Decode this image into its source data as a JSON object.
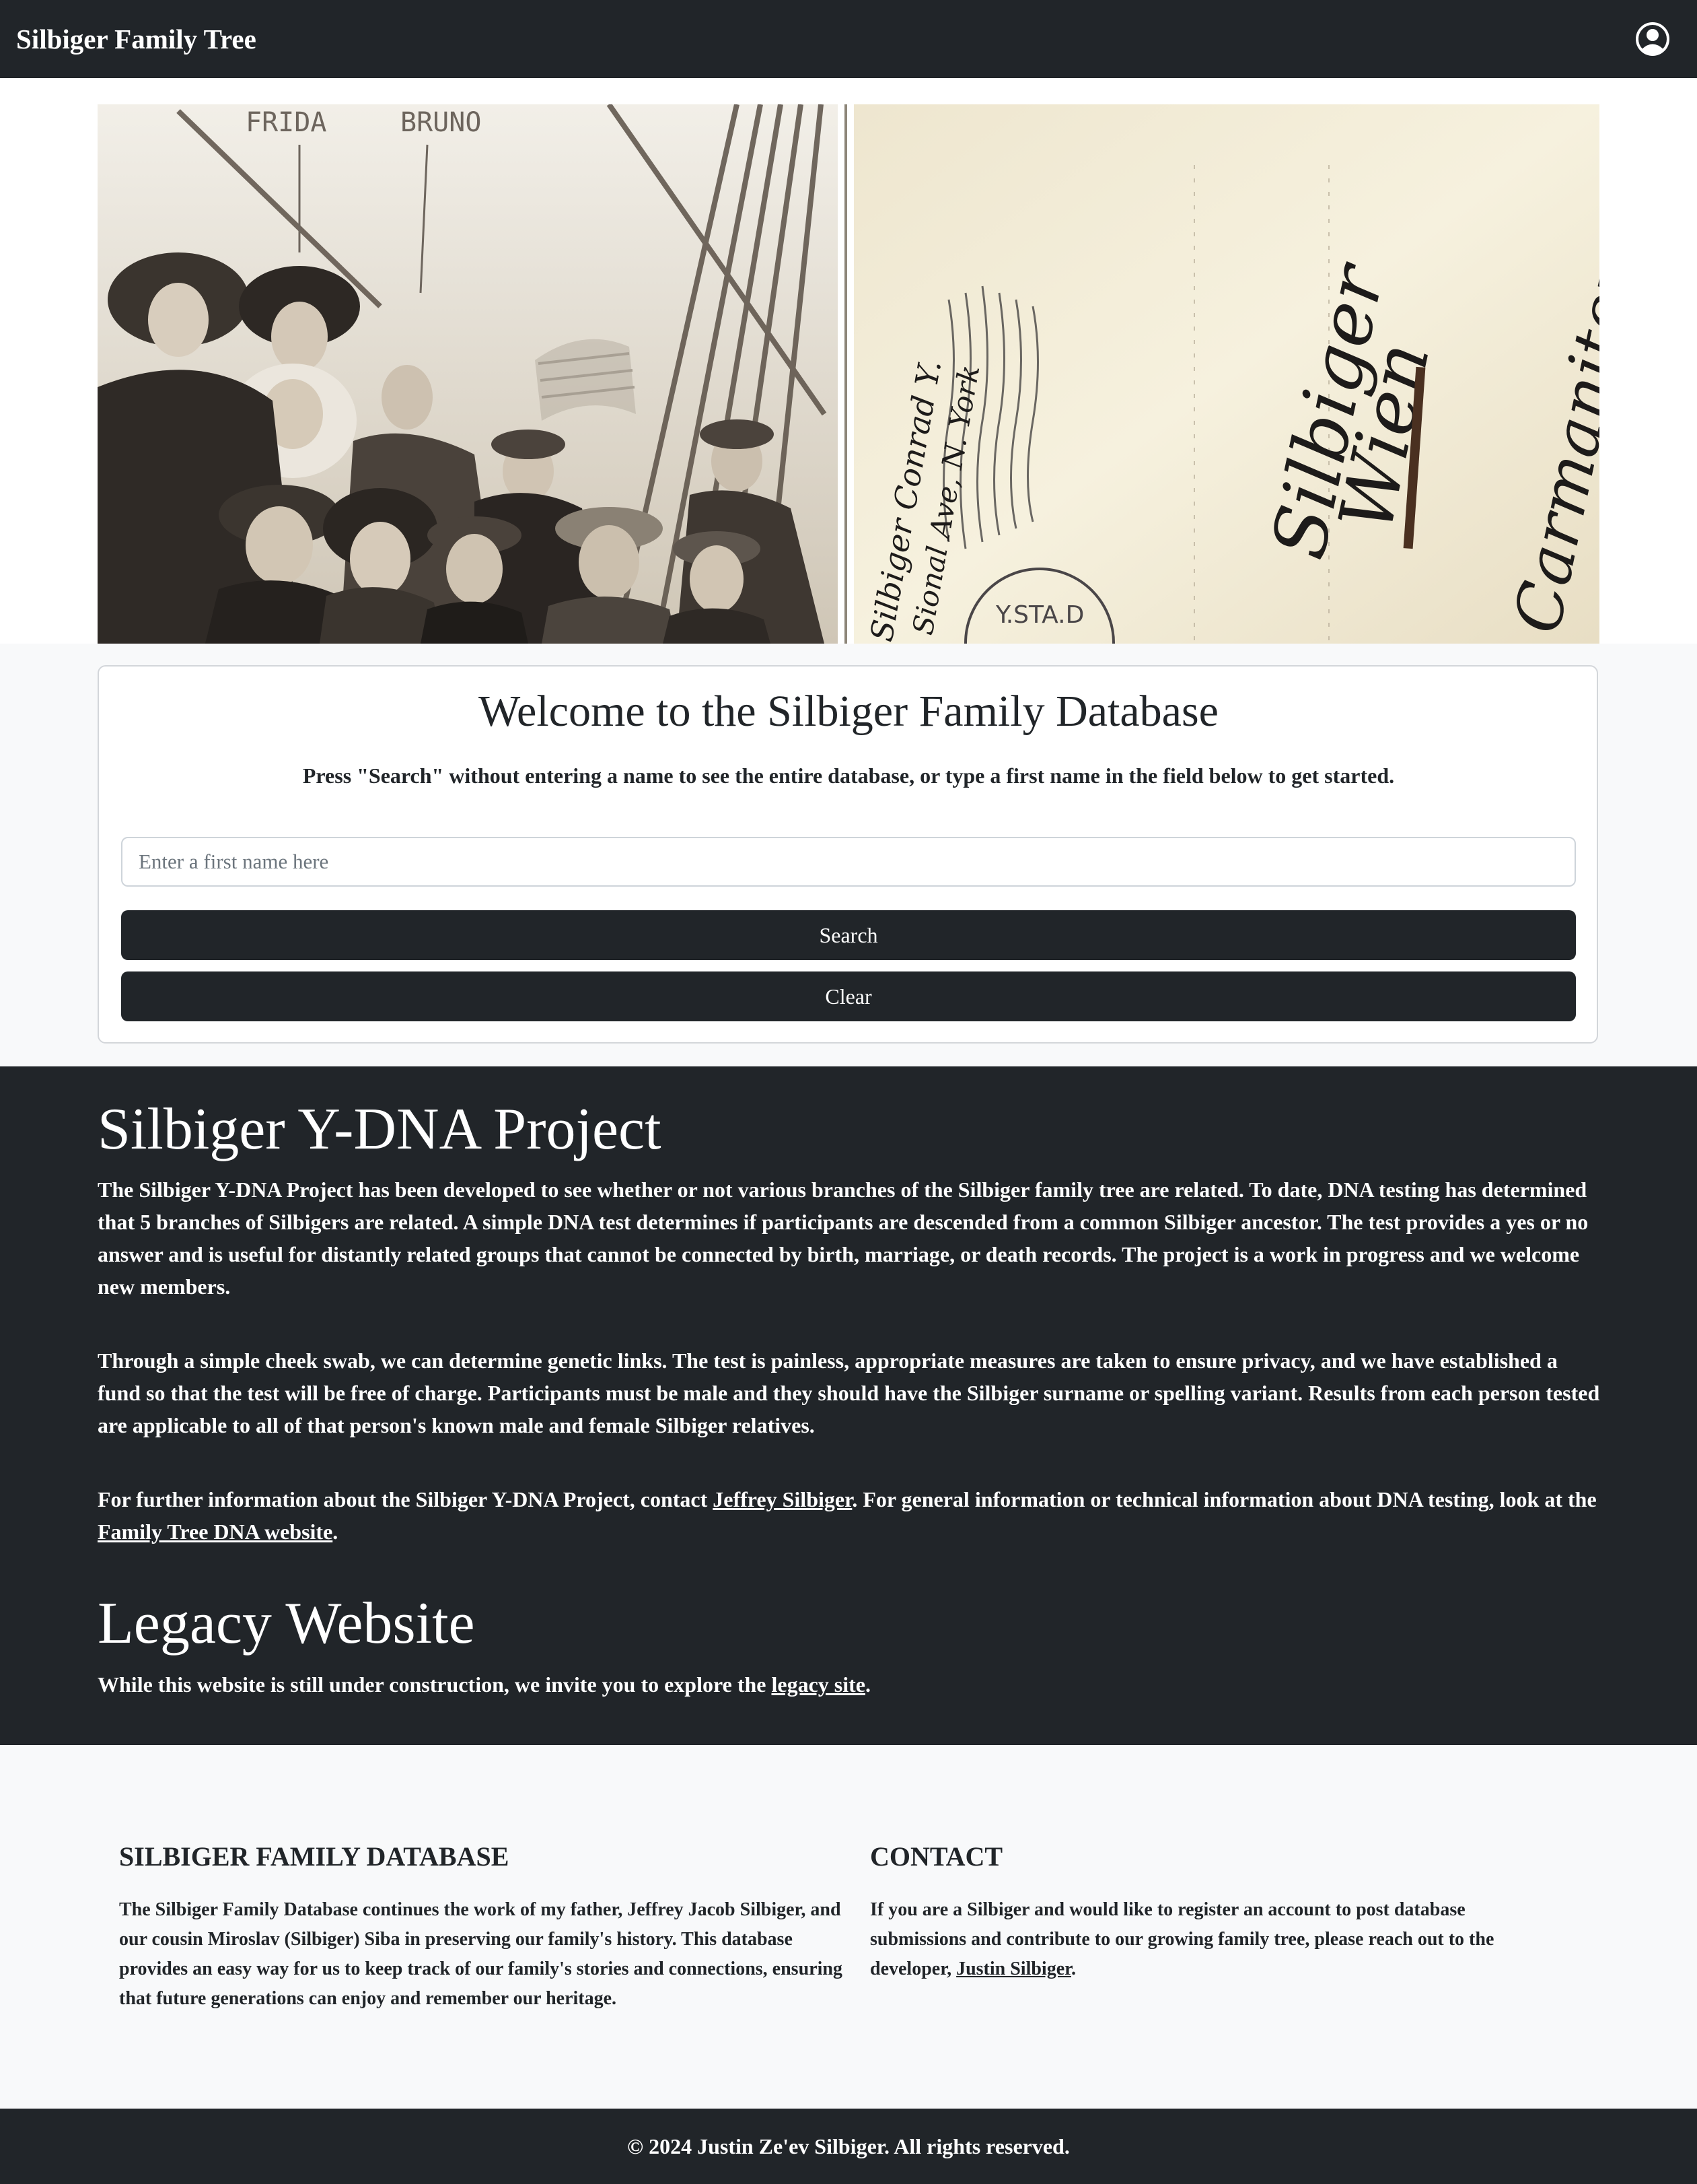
{
  "navbar": {
    "brand": "Silbiger Family Tree",
    "user_icon": "user-circle-icon"
  },
  "hero": {
    "photo_annotations": [
      "FRIDA",
      "BRUNO"
    ],
    "postcard_text": [
      "Silbiger Conrad Y.",
      "Sional Ave, N. York",
      "Silbiger",
      "Wien",
      "Carmaniterg, H"
    ],
    "postmark": "Y.STA.D"
  },
  "welcome": {
    "title": "Welcome to the Silbiger Family Database",
    "subtitle": "Press \"Search\" without entering a name to see the entire database, or type a first name in the field below to get started.",
    "search_placeholder": "Enter a first name here",
    "search_value": "",
    "search_button": "Search",
    "clear_button": "Clear"
  },
  "dna": {
    "title": "Silbiger Y-DNA Project",
    "p1": "The Silbiger Y-DNA Project has been developed to see whether or not various branches of the Silbiger family tree are related. To date, DNA testing has determined that 5 branches of Silbigers are related. A simple DNA test determines if participants are descended from a common Silbiger ancestor. The test provides a yes or no answer and is useful for distantly related groups that cannot be connected by birth, marriage, or death records. The project is a work in progress and we welcome new members.",
    "p2": "Through a simple cheek swab, we can determine genetic links. The test is painless, appropriate measures are taken to ensure privacy, and we have established a fund so that the test will be free of charge. Participants must be male and they should have the Silbiger surname or spelling variant. Results from each person tested are applicable to all of that person's known male and female Silbiger relatives.",
    "p3_before": "For further information about the Silbiger Y-DNA Project, contact ",
    "p3_link1": "Jeffrey Silbiger",
    "p3_middle": ". For general information or technical information about DNA testing, look at the ",
    "p3_link2": "Family Tree DNA website",
    "p3_after": "."
  },
  "legacy": {
    "title": "Legacy Website",
    "text_before": "While this website is still under construction, we invite you to explore the ",
    "link": "legacy site",
    "text_after": "."
  },
  "info": {
    "about_title": "SILBIGER FAMILY DATABASE",
    "about_text": "The Silbiger Family Database continues the work of my father, Jeffrey Jacob Silbiger, and our cousin Miroslav (Silbiger) Siba in preserving our family's history. This database provides an easy way for us to keep track of our family's stories and connections, ensuring that future generations can enjoy and remember our heritage.",
    "contact_title": "CONTACT",
    "contact_before": "If you are a Silbiger and would like to register an account to post database submissions and contribute to our growing family tree, please reach out to the developer, ",
    "contact_link": "Justin Silbiger",
    "contact_after": "."
  },
  "footer": {
    "copyright": "© 2024 Justin Ze'ev Silbiger. All rights reserved."
  }
}
